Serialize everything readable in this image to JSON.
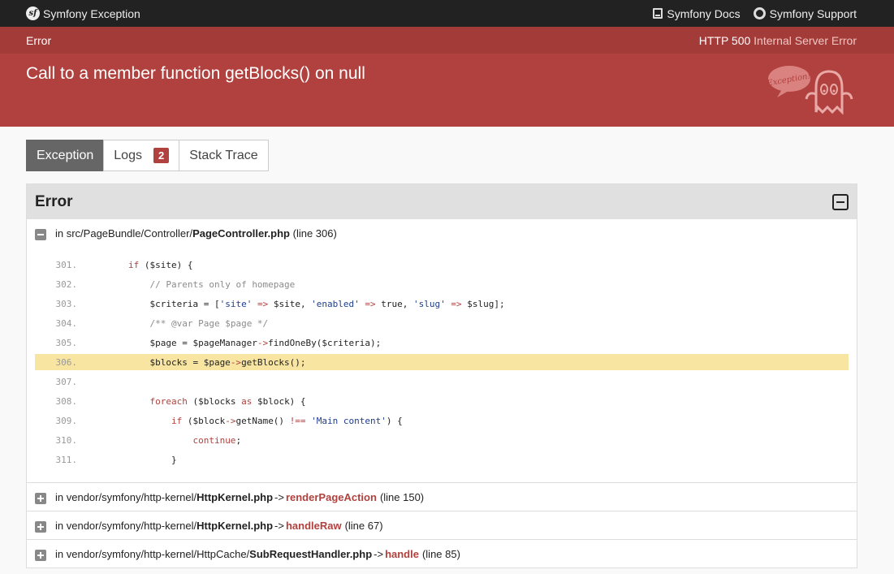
{
  "topbar": {
    "brand": "Symfony Exception",
    "links": [
      {
        "label": "Symfony Docs",
        "icon": "book-icon"
      },
      {
        "label": "Symfony Support",
        "icon": "support-icon"
      }
    ]
  },
  "status": {
    "left": "Error",
    "code": "HTTP 500",
    "text": "Internal Server Error"
  },
  "exception": {
    "message": "Call to a member function getBlocks() on null",
    "mascot_text": "Exception!"
  },
  "tabs": [
    {
      "label": "Exception",
      "active": true
    },
    {
      "label": "Logs",
      "badge": "2"
    },
    {
      "label": "Stack Trace"
    }
  ],
  "panel": {
    "title": "Error",
    "first_trace": {
      "prefix": "in src/PageBundle/Controller/",
      "file": "PageController.php",
      "line": "(line 306)"
    },
    "code_lines": [
      {
        "num": "301.",
        "html": "        <span class=\"kw\">if</span> ($site) {"
      },
      {
        "num": "302.",
        "html": "            <span class=\"com\">// Parents only of homepage</span>"
      },
      {
        "num": "303.",
        "html": "            $criteria = [<span class=\"str\">'site'</span> <span class=\"kw\">=&gt;</span> $site, <span class=\"str\">'enabled'</span> <span class=\"kw\">=&gt;</span> true, <span class=\"str\">'slug'</span> <span class=\"kw\">=&gt;</span> $slug];"
      },
      {
        "num": "304.",
        "html": "            <span class=\"com\">/** @var Page $page */</span>"
      },
      {
        "num": "305.",
        "html": "            $page = $pageManager<span class=\"kw\">-&gt;</span>findOneBy($criteria);"
      },
      {
        "num": "306.",
        "html": "            $blocks = $page<span class=\"kw\">-&gt;</span>getBlocks();",
        "highlight": true
      },
      {
        "num": "307.",
        "html": ""
      },
      {
        "num": "308.",
        "html": "            <span class=\"kw\">foreach</span> ($blocks <span class=\"kw\">as</span> $block) {"
      },
      {
        "num": "309.",
        "html": "                <span class=\"kw\">if</span> ($block<span class=\"kw\">-&gt;</span>getName() <span class=\"kw\">!==</span> <span class=\"str\">'Main content'</span>) {"
      },
      {
        "num": "310.",
        "html": "                    <span class=\"kw\">continue</span>;"
      },
      {
        "num": "311.",
        "html": "                }"
      }
    ],
    "traces": [
      {
        "prefix": "in vendor/symfony/http-kernel/",
        "file": "HttpKernel.php",
        "arrow": "->",
        "fn": "renderPageAction",
        "line": "(line 150)"
      },
      {
        "prefix": "in vendor/symfony/http-kernel/",
        "file": "HttpKernel.php",
        "arrow": "->",
        "fn": "handleRaw",
        "line": "(line 67)"
      },
      {
        "prefix": "in vendor/symfony/http-kernel/HttpCache/",
        "file": "SubRequestHandler.php",
        "arrow": "->",
        "fn": "handle",
        "line": "(line 85)"
      }
    ]
  },
  "colors": {
    "header_dark": "#a33b38",
    "header": "#b0413e",
    "highlight": "#f8e5a1"
  }
}
